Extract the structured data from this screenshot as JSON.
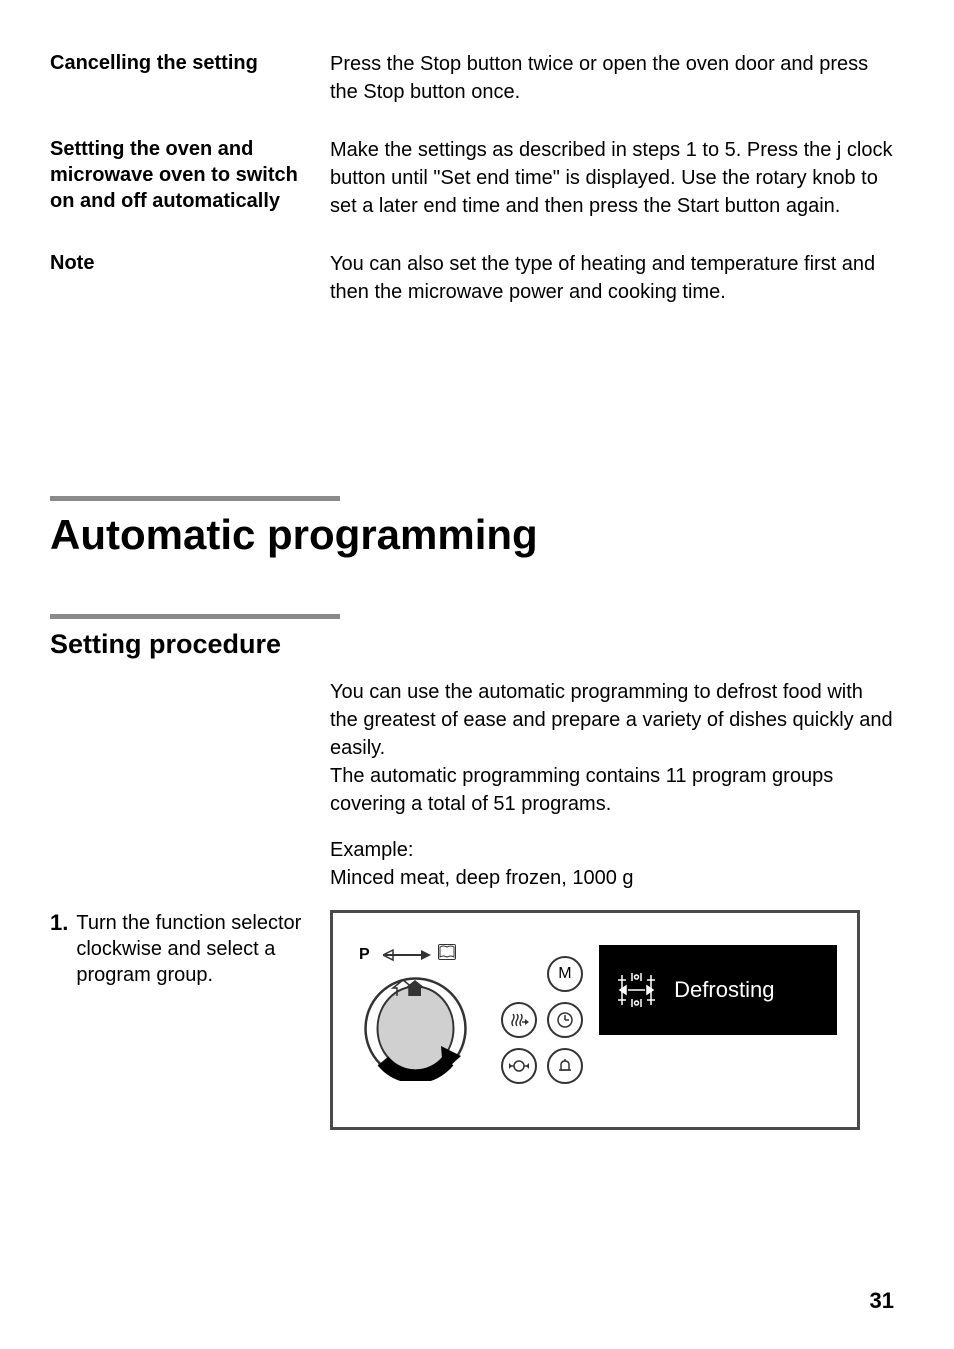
{
  "sections": {
    "cancelling": {
      "heading": "Cancelling the setting",
      "body": "Press the Stop button twice or open the oven door and press the Stop button once."
    },
    "setting_auto": {
      "heading": "Settting the oven and microwave oven to switch on and off automatically",
      "body": "Make the settings as described in steps 1 to 5. Press the j clock button until \"Set end time\" is displayed. Use the rotary knob to set a later end time and then press the Start button again."
    },
    "note": {
      "heading": "Note",
      "body": "You can also set the type of heating and temperature first and then the microwave power and cooking time."
    }
  },
  "main_heading": "Automatic programming",
  "sub_heading": "Setting procedure",
  "intro_body1": "You can use the automatic programming to defrost food with the greatest of ease and prepare a variety of dishes quickly and easily.",
  "intro_body2": "The automatic programming contains 11 program groups covering a total of 51 programs.",
  "example_label": "Example:",
  "example_text": "Minced meat, deep frozen, 1000 g",
  "step1": {
    "num": "1.",
    "text": "Turn the function selector clockwise and select a program group."
  },
  "panel": {
    "p_label": "P",
    "m_label": "M",
    "screen_text": "Defrosting"
  },
  "page_number": "31"
}
